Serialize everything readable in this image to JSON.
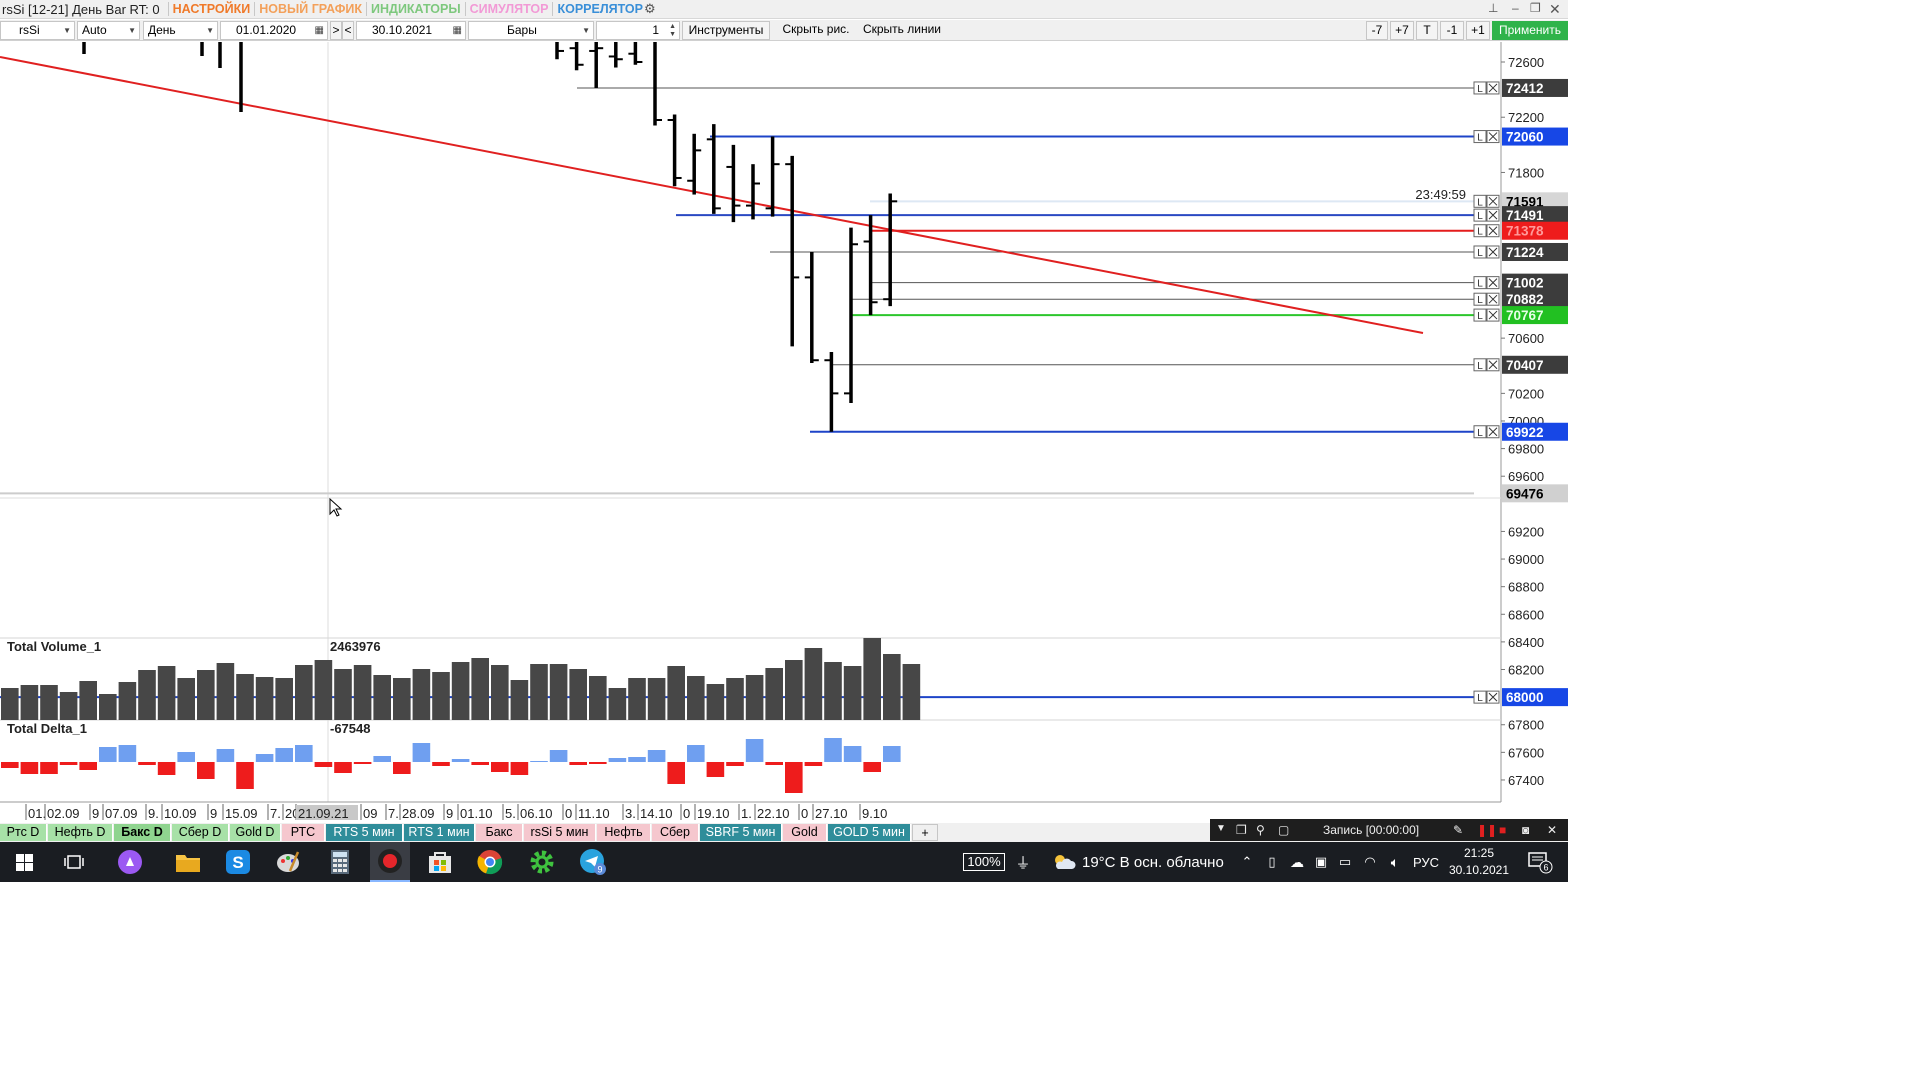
{
  "window": {
    "title": "rsSi [12-21] День Bar RT: 0",
    "menus": [
      {
        "label": "НАСТРОЙКИ",
        "color": "#f07a2a"
      },
      {
        "label": "НОВЫЙ ГРАФИК",
        "color": "#f3a05a"
      },
      {
        "label": "ИНДИКАТОРЫ",
        "color": "#7ec87e"
      },
      {
        "label": "СИМУЛЯТОР",
        "color": "#f29ad6"
      },
      {
        "label": "КОРРЕЛЯТОР",
        "color": "#3a8fd8"
      }
    ]
  },
  "toolbar": {
    "symbol": "rsSi",
    "scale": "Auto",
    "period": "День",
    "date_from": "01.01.2020",
    "nav_next": ">",
    "nav_prev": "<",
    "date_to": "30.10.2021",
    "chart_type": "Бары",
    "bar_count": "1",
    "instruments": "Инструменты",
    "hide_drawings": "Скрыть рис.",
    "hide_lines": "Скрыть линии",
    "btn_m7": "-7",
    "btn_p7": "+7",
    "btn_t": "T",
    "btn_m1": "-1",
    "btn_p1": "+1",
    "apply": "Применить"
  },
  "chart_data": {
    "type": "bar",
    "price_axis": {
      "ticks": [
        "72600",
        "72200",
        "71800",
        "70600",
        "70200",
        "70000",
        "69800",
        "69600",
        "69200",
        "69000",
        "68800",
        "68600",
        "68400",
        "68200",
        "67800",
        "67600",
        "67400"
      ],
      "ylim": [
        67400,
        72600
      ]
    },
    "time_axis": {
      "ticks": [
        "01.",
        "02.09",
        "9",
        "07.09",
        "9.",
        "10.09",
        "9",
        "15.09",
        "7.",
        "20",
        "21.09.21",
        "09",
        "7.",
        "28.09",
        "9",
        "01.10",
        "5.",
        "06.10",
        "0",
        "11.10",
        "3.",
        "14.10",
        "0",
        "19.10",
        "1.",
        "22.10",
        "0",
        "27.10",
        "9.10"
      ]
    },
    "bars": [
      {
        "date": "2021-09-28",
        "open": 72760,
        "high": 72880,
        "low": 72620,
        "close": 72680
      },
      {
        "date": "2021-09-29",
        "open": 72700,
        "high": 72880,
        "low": 72540,
        "close": 72580
      },
      {
        "date": "2021-09-30",
        "open": 72680,
        "high": 72880,
        "low": 72412,
        "close": 72700
      },
      {
        "date": "2021-10-01",
        "open": 72640,
        "high": 72880,
        "low": 72560,
        "close": 72620
      },
      {
        "date": "2021-10-04",
        "open": 72660,
        "high": 72880,
        "low": 72580,
        "close": 72600
      },
      {
        "date": "2021-10-05",
        "open": 72820,
        "high": 72880,
        "low": 72140,
        "close": 72180
      },
      {
        "date": "2021-10-06",
        "open": 72180,
        "high": 72220,
        "low": 71700,
        "close": 71760
      },
      {
        "date": "2021-10-07",
        "open": 71740,
        "high": 72080,
        "low": 71640,
        "close": 71960
      },
      {
        "date": "2021-10-08",
        "open": 72040,
        "high": 72150,
        "low": 71500,
        "close": 71540
      },
      {
        "date": "2021-10-11",
        "open": 71840,
        "high": 72000,
        "low": 71440,
        "close": 71560
      },
      {
        "date": "2021-10-12",
        "open": 71560,
        "high": 71860,
        "low": 71460,
        "close": 71720
      },
      {
        "date": "2021-10-13",
        "open": 71540,
        "high": 72060,
        "low": 71480,
        "close": 71860
      },
      {
        "date": "2021-10-14",
        "open": 71860,
        "high": 71920,
        "low": 70540,
        "close": 71040
      },
      {
        "date": "2021-10-15",
        "open": 71040,
        "high": 71224,
        "low": 70420,
        "close": 70440
      },
      {
        "date": "2021-10-18",
        "open": 70440,
        "high": 70500,
        "low": 69922,
        "close": 70200
      },
      {
        "date": "2021-10-19",
        "open": 70200,
        "high": 71400,
        "low": 70130,
        "close": 71280
      },
      {
        "date": "2021-10-20",
        "open": 71300,
        "high": 71491,
        "low": 70767,
        "close": 70860
      },
      {
        "date": "2021-10-21",
        "open": 70882,
        "high": 71648,
        "low": 70832,
        "close": 71591
      }
    ],
    "trend_line": {
      "color": "#e02020"
    },
    "levels": [
      {
        "price": 72412,
        "label": "72412",
        "line": "#555555",
        "bg": "#3c3c3c",
        "fg": "#ffffff"
      },
      {
        "price": 72060,
        "label": "72060",
        "line": "#1e44c8",
        "bg": "#1747e6",
        "fg": "#ffffff"
      },
      {
        "price": 71591,
        "label": "71591",
        "line": "#dde8f4",
        "bg": "#d6d6d6",
        "fg": "#000000"
      },
      {
        "price": 71491,
        "label": "71491",
        "line": "#2a48c2",
        "bg": "#3c3c3c",
        "fg": "#ffffff"
      },
      {
        "price": 71378,
        "label": "71378",
        "line": "#e41c1c",
        "bg": "#ee1c1c",
        "fg": "#ff9a9a"
      },
      {
        "price": 71224,
        "label": "71224",
        "line": "#555555",
        "bg": "#3c3c3c",
        "fg": "#ffffff"
      },
      {
        "price": 71002,
        "label": "71002",
        "line": "#555555",
        "bg": "#3c3c3c",
        "fg": "#ffffff"
      },
      {
        "price": 70882,
        "label": "70882",
        "line": "#555555",
        "bg": "#3c3c3c",
        "fg": "#ffffff"
      },
      {
        "price": 70767,
        "label": "70767",
        "line": "#2cc62c",
        "bg": "#22c022",
        "fg": "#e6ffe6"
      },
      {
        "price": 70407,
        "label": "70407",
        "line": "#555555",
        "bg": "#3c3c3c",
        "fg": "#ffffff"
      },
      {
        "price": 69922,
        "label": "69922",
        "line": "#1e44c8",
        "bg": "#1747e6",
        "fg": "#ffffff"
      },
      {
        "price": 69476,
        "label": "69476",
        "line": "#cccccc",
        "bg": "#d0d0d0",
        "fg": "#000000"
      },
      {
        "price": 68000,
        "label": "68000",
        "line": "#1e44c8",
        "bg": "#1747e6",
        "fg": "#ffffff"
      }
    ],
    "timer": "23:49:59",
    "volume": {
      "name": "Total Volume_1",
      "last": "2463976",
      "values": [
        32,
        35,
        35,
        28,
        39,
        26,
        38,
        50,
        54,
        42,
        50,
        57,
        46,
        43,
        42,
        55,
        60,
        51,
        55,
        45,
        42,
        51,
        48,
        58,
        62,
        55,
        40,
        56,
        56,
        51,
        44,
        32,
        42,
        42,
        54,
        44,
        36,
        42,
        45,
        52,
        60,
        72,
        58,
        54,
        82,
        66,
        56
      ]
    },
    "delta": {
      "name": "Total Delta_1",
      "last": "-67548",
      "values": [
        -6,
        -12,
        -12,
        -3,
        -8,
        15,
        17,
        -3,
        -13,
        10,
        -17,
        13,
        -27,
        8,
        14,
        17,
        -5,
        -11,
        -2,
        6,
        -12,
        19,
        -4,
        3,
        -3,
        -10,
        -13,
        1,
        12,
        -3,
        -2,
        4,
        5,
        12,
        -22,
        17,
        -15,
        -4,
        23,
        -3,
        -31,
        -4,
        24,
        16,
        -10,
        16
      ]
    }
  },
  "tabs": [
    {
      "label": "Ртс D",
      "bg": "#a7e1a7",
      "fg": "#000000"
    },
    {
      "label": "Нефть D",
      "bg": "#a7e1a7",
      "fg": "#000000"
    },
    {
      "label": "Бакс D",
      "bg": "#8fd48f",
      "fg": "#000000",
      "bold": true
    },
    {
      "label": "Сбер D",
      "bg": "#a7e1a7",
      "fg": "#000000"
    },
    {
      "label": "Gold D",
      "bg": "#a7e1a7",
      "fg": "#000000"
    },
    {
      "label": "РТС",
      "bg": "#f5c7ce",
      "fg": "#000000"
    },
    {
      "label": "RTS 5 мин",
      "bg": "#2f8d9a",
      "fg": "#ffffff"
    },
    {
      "label": "RTS 1 мин",
      "bg": "#2f8d9a",
      "fg": "#ffffff"
    },
    {
      "label": "Бакс",
      "bg": "#f5c7ce",
      "fg": "#000000"
    },
    {
      "label": "rsSi 5 мин",
      "bg": "#f5c7ce",
      "fg": "#000000"
    },
    {
      "label": "Нефть",
      "bg": "#f5c7ce",
      "fg": "#000000"
    },
    {
      "label": "Сбер",
      "bg": "#f5c7ce",
      "fg": "#000000"
    },
    {
      "label": "SBRF 5 мин",
      "bg": "#2f8d9a",
      "fg": "#ffffff"
    },
    {
      "label": "Gold",
      "bg": "#f5c7ce",
      "fg": "#000000"
    },
    {
      "label": "GOLD 5 мин",
      "bg": "#2f8d9a",
      "fg": "#ffffff"
    },
    {
      "label": "+",
      "bg": "#f0f0f0",
      "fg": "#000000"
    }
  ],
  "recorder": {
    "label": "Запись [00:00:00]"
  },
  "taskbar": {
    "battery": "100%",
    "weather": "19°C  В осн. облачно",
    "lang": "РУС",
    "time": "21:25",
    "date": "30.10.2021",
    "notifications": "6",
    "telegram_badge": "9"
  }
}
